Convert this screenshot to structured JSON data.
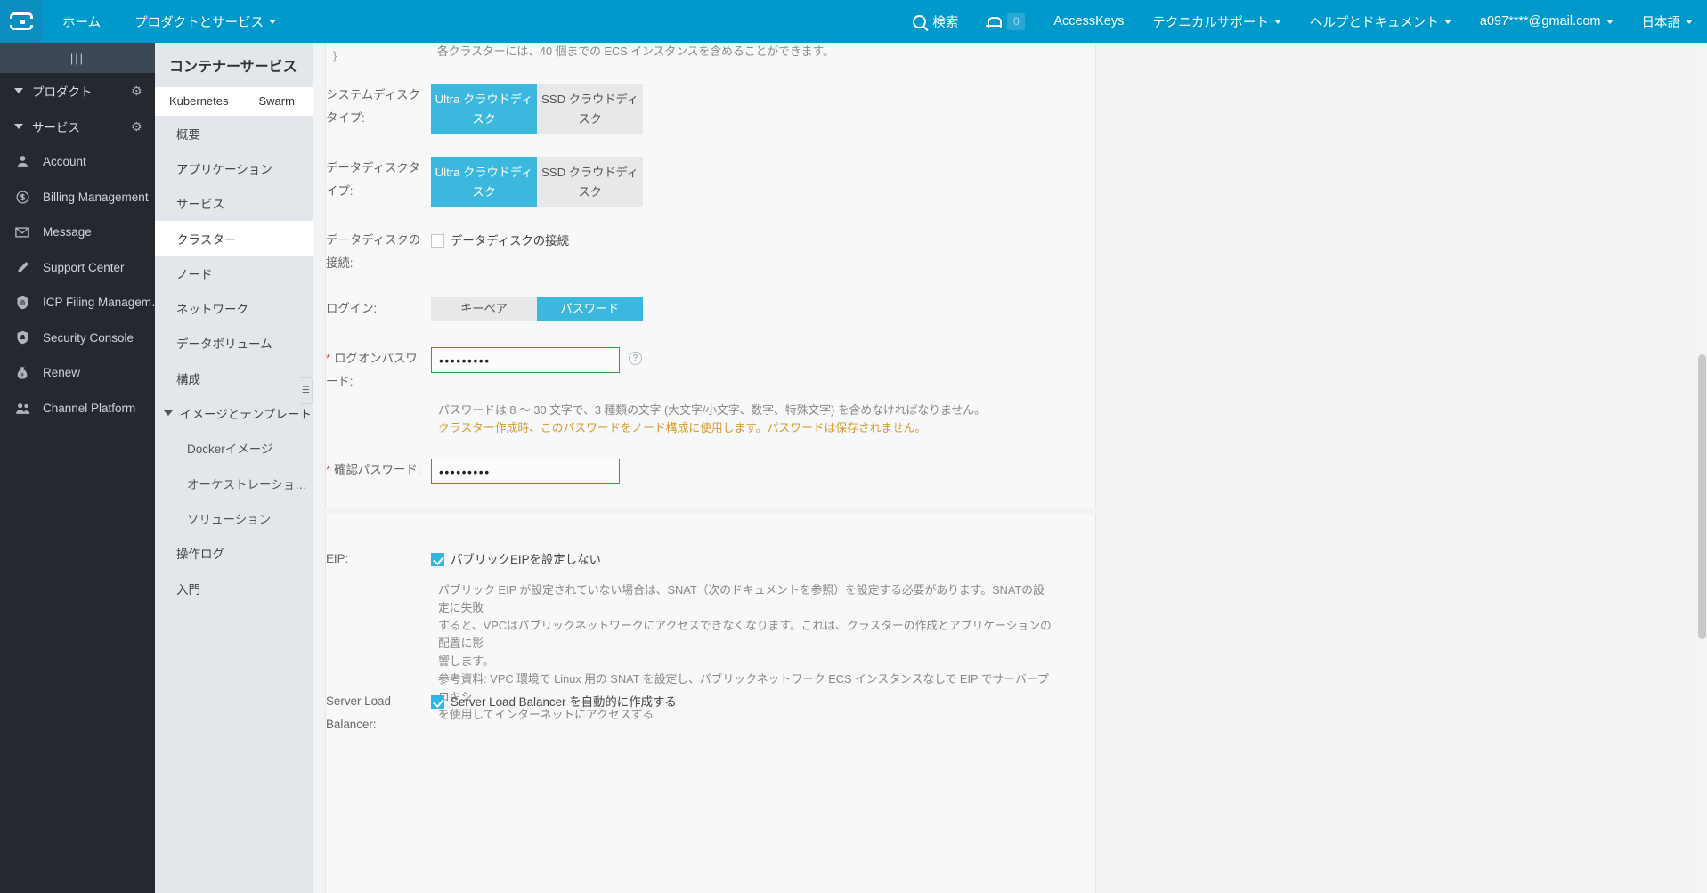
{
  "topbar": {
    "logo_name": "alibaba-cloud-logo",
    "home": "ホーム",
    "products": "プロダクトとサービス",
    "search": "検索",
    "notification_count": "0",
    "access_keys": "AccessKeys",
    "tech_support": "テクニカルサポート",
    "help_docs": "ヘルプとドキュメント",
    "account": "a097****@gmail.com",
    "language": "日本語"
  },
  "sidebar": {
    "handle": "|||",
    "groups": [
      {
        "label": "プロダクト"
      },
      {
        "label": "サービス"
      }
    ],
    "items": [
      {
        "label": "Account",
        "icon": "user-icon"
      },
      {
        "label": "Billing Management",
        "icon": "dollar-circle-icon"
      },
      {
        "label": "Message",
        "icon": "envelope-icon"
      },
      {
        "label": "Support Center",
        "icon": "pencil-icon"
      },
      {
        "label": "ICP Filing Managem…",
        "icon": "shield-badge-icon"
      },
      {
        "label": "Security Console",
        "icon": "shield-icon"
      },
      {
        "label": "Renew",
        "icon": "money-bag-icon"
      },
      {
        "label": "Channel Platform",
        "icon": "users-icon"
      }
    ]
  },
  "subnav": {
    "title": "コンテナーサービス",
    "tabs": [
      {
        "label": "Kubernetes",
        "active": true
      },
      {
        "label": "Swarm",
        "active": false
      }
    ],
    "items": [
      {
        "label": "概要",
        "active": false,
        "type": "leaf"
      },
      {
        "label": "アプリケーション",
        "active": false,
        "type": "leaf"
      },
      {
        "label": "サービス",
        "active": false,
        "type": "leaf"
      },
      {
        "label": "クラスター",
        "active": true,
        "type": "leaf"
      },
      {
        "label": "ノード",
        "active": false,
        "type": "leaf"
      },
      {
        "label": "ネットワーク",
        "active": false,
        "type": "leaf"
      },
      {
        "label": "データボリューム",
        "active": false,
        "type": "leaf"
      },
      {
        "label": "構成",
        "active": false,
        "type": "leaf"
      },
      {
        "label": "イメージとテンプレート",
        "active": false,
        "type": "expandable"
      },
      {
        "label": "Dockerイメージ",
        "active": false,
        "type": "child"
      },
      {
        "label": "オーケストレーショ…",
        "active": false,
        "type": "child"
      },
      {
        "label": "ソリューション",
        "active": false,
        "type": "child"
      },
      {
        "label": "操作ログ",
        "active": false,
        "type": "leaf"
      },
      {
        "label": "入門",
        "active": false,
        "type": "leaf"
      }
    ]
  },
  "form": {
    "cluster_note": "各クラスターには、40 個までの ECS インスタンスを含めることができます。",
    "system_disk": {
      "label": "システムディスクタイプ:",
      "options": [
        {
          "label": "Ultra クラウドディスク",
          "selected": true
        },
        {
          "label": "SSD クラウドディスク",
          "selected": false
        }
      ]
    },
    "data_disk": {
      "label": "データディスクタイプ:",
      "options": [
        {
          "label": "Ultra クラウドディスク",
          "selected": true
        },
        {
          "label": "SSD クラウドディスク",
          "selected": false
        }
      ]
    },
    "attach_data_disk": {
      "label": "データディスクの接続:",
      "checkbox_label": "データディスクの接続",
      "checked": false
    },
    "login": {
      "label": "ログイン:",
      "options": [
        {
          "label": "キーペア",
          "selected": false
        },
        {
          "label": "パスワード",
          "selected": true
        }
      ]
    },
    "logon_password": {
      "label": "ログオンパスワード:",
      "value": "•••••••••",
      "required": true,
      "help": "?"
    },
    "password_rule": "パスワードは 8 ～ 30 文字で、3 種類の文字 (大文字/小文字、数字、特殊文字) を含めなければなりません。",
    "password_warning": "クラスター作成時、このパスワードをノード構成に使用します。パスワードは保存されません。",
    "confirm_password": {
      "label": "確認パスワード:",
      "value": "•••••••••",
      "required": true
    },
    "eip": {
      "label": "EIP:",
      "checkbox_label": "パブリックEIPを設定しない",
      "checked": true,
      "desc_line1": "パブリック EIP が設定されていない場合は、SNAT（次のドキュメントを参照）を設定する必要があります。SNATの設定に失敗",
      "desc_line2": "すると、VPCはパブリックネットワークにアクセスできなくなります。これは、クラスターの作成とアプリケーションの配置に影",
      "desc_line3": "響します。",
      "desc_line4": "参考資料: VPC 環境で Linux 用の SNAT を設定し、パブリックネットワーク ECS インスタンスなしで EIP でサーバープロキシ",
      "desc_line5": "を使用してインターネットにアクセスする"
    },
    "slb": {
      "label": "Server Load Balancer:",
      "checkbox_label": "Server Load Balancer を自動的に作成する",
      "checked": true
    }
  },
  "colors": {
    "brand": "#0099cc",
    "accent_selected": "#3cb8de",
    "checkbox_on": "#30b7e0",
    "warning_text": "#d89a2a",
    "input_border_valid": "#3a9c3a",
    "sidebar_bg": "#24292f",
    "subnav_bg": "#e3e7eb"
  }
}
